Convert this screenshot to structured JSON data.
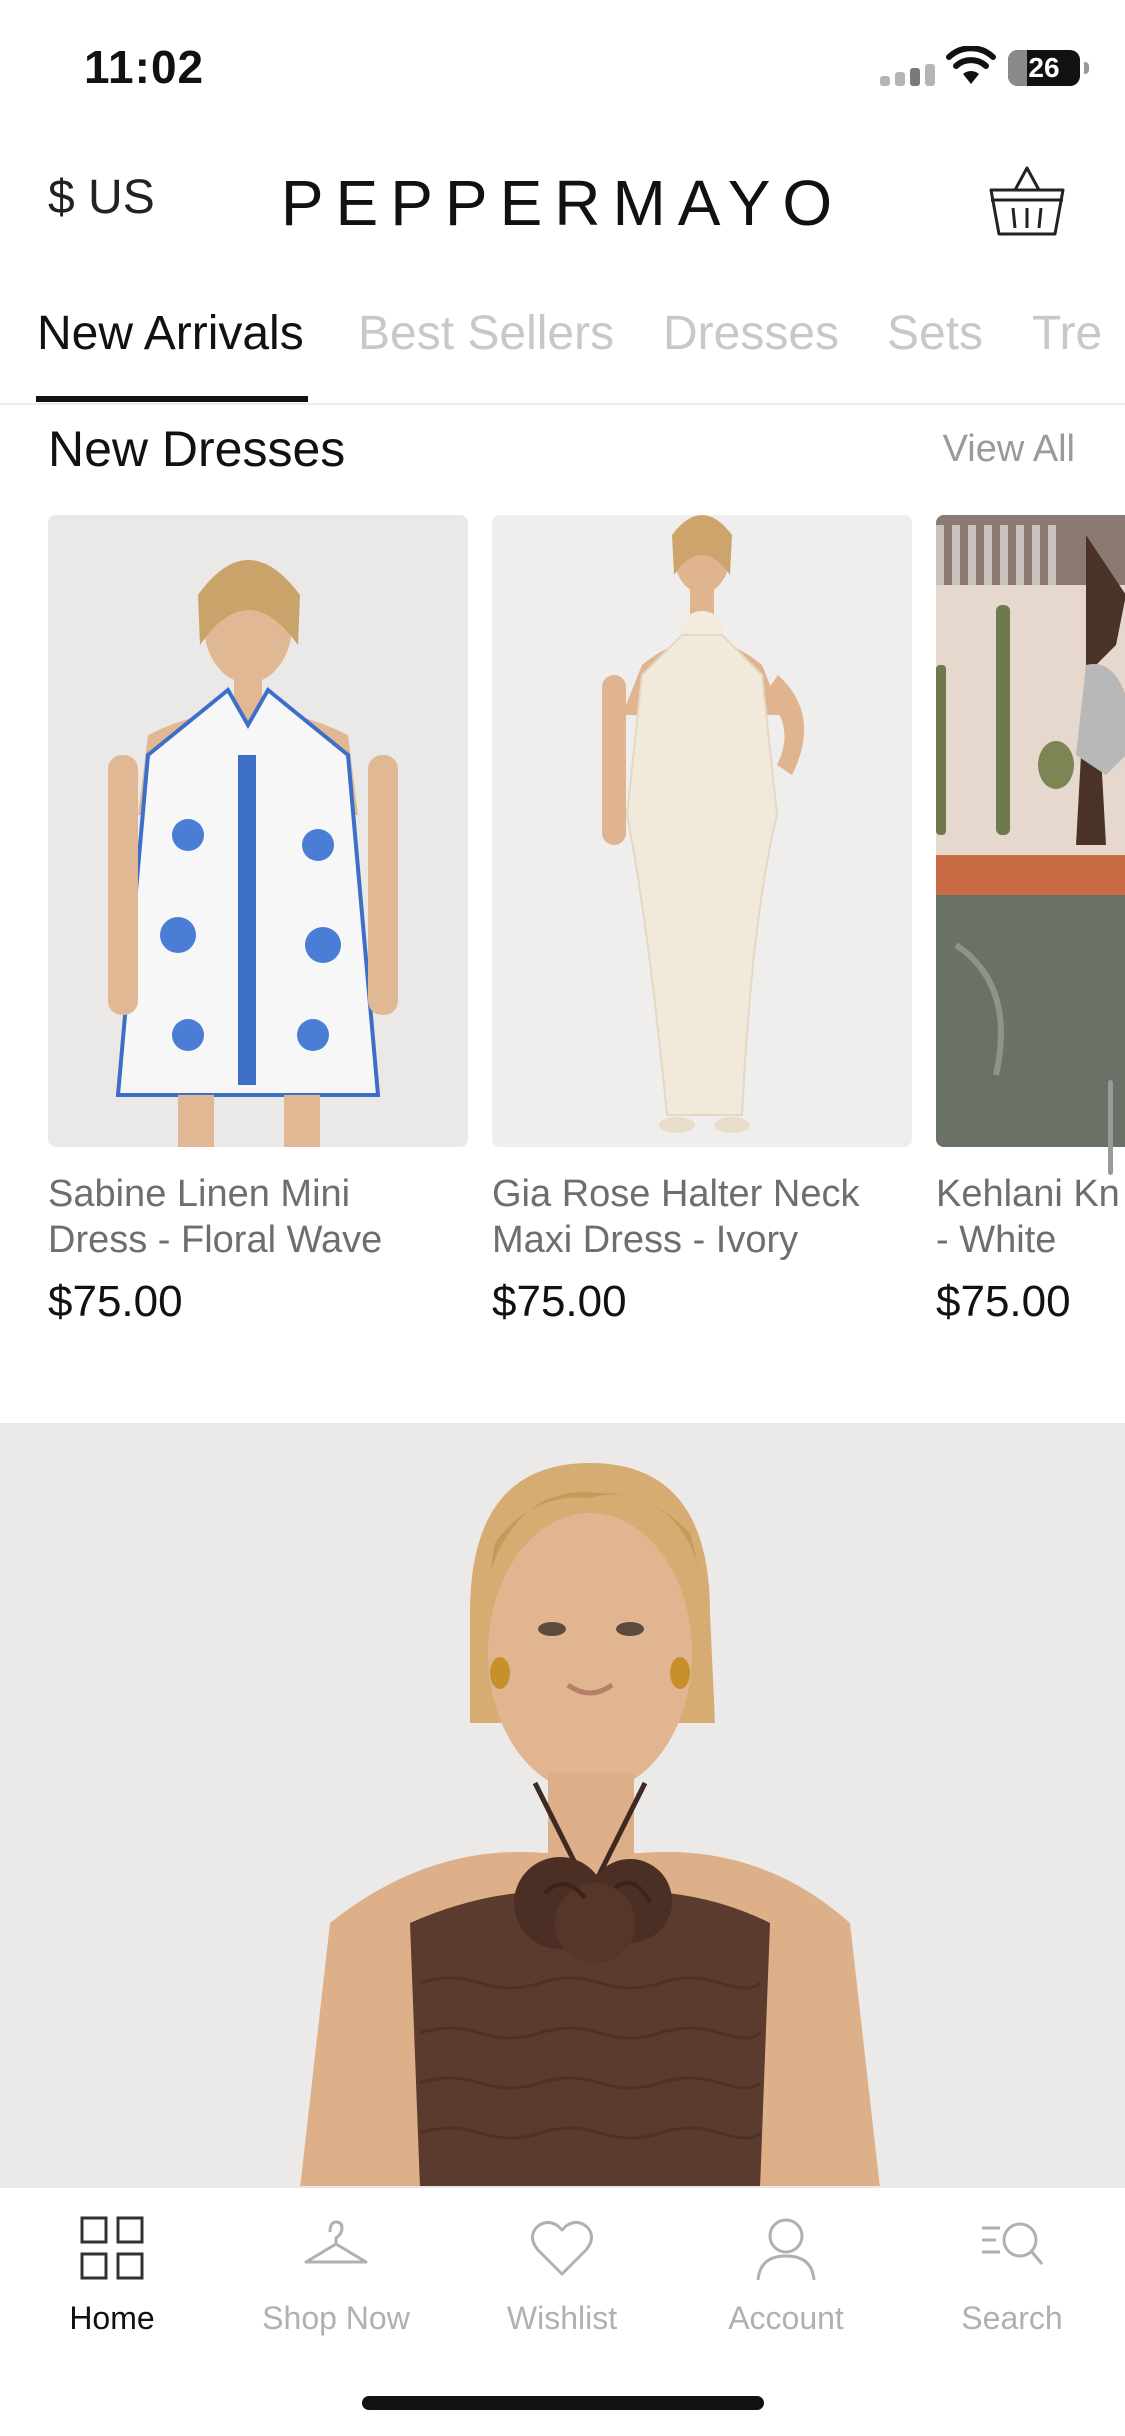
{
  "status_bar": {
    "time": "11:02",
    "battery": "26",
    "battery_level": 0.26
  },
  "header": {
    "currency": "$ US",
    "logo": "PEPPERMAYO"
  },
  "tabs": [
    {
      "label": "New Arrivals",
      "active": true
    },
    {
      "label": "Best Sellers",
      "active": false
    },
    {
      "label": "Dresses",
      "active": false
    },
    {
      "label": "Sets",
      "active": false
    },
    {
      "label": "Tre",
      "active": false
    }
  ],
  "section": {
    "title": "New Dresses",
    "view_all": "View All"
  },
  "products": [
    {
      "name_line1": "Sabine Linen Mini",
      "name_line2": "Dress - Floral Wave",
      "price": "$75.00"
    },
    {
      "name_line1": "Gia Rose Halter Neck",
      "name_line2": "Maxi Dress - Ivory",
      "price": "$75.00"
    },
    {
      "name_line1": "Kehlani Kn",
      "name_line2": "- White",
      "price": "$75.00"
    }
  ],
  "bottom_nav": [
    {
      "label": "Home",
      "icon": "grid-icon",
      "active": true
    },
    {
      "label": "Shop Now",
      "icon": "hanger-icon",
      "active": false
    },
    {
      "label": "Wishlist",
      "icon": "heart-icon",
      "active": false
    },
    {
      "label": "Account",
      "icon": "user-icon",
      "active": false
    },
    {
      "label": "Search",
      "icon": "search-list-icon",
      "active": false
    }
  ],
  "colors": {
    "accent": "#111111",
    "inactive": "#c8c8c8",
    "muted": "#6e6e6e"
  }
}
